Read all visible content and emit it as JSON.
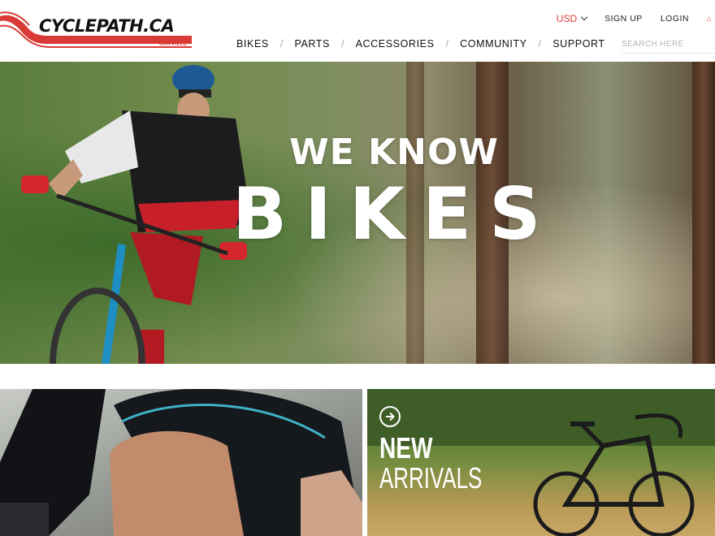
{
  "brand": {
    "name": "CYCLEPATH.CA",
    "location": "OAKVILLE",
    "color": "#d93a35"
  },
  "top_links": {
    "currency": "USD",
    "signup": "SIGN UP",
    "login": "LOGIN"
  },
  "nav": {
    "items": [
      "BIKES",
      "PARTS",
      "ACCESSORIES",
      "COMMUNITY",
      "SUPPORT"
    ],
    "separator": "/"
  },
  "search": {
    "placeholder": "SEARCH HERE",
    "value": ""
  },
  "hero": {
    "line1": "WE KNOW",
    "line2": "BIKES"
  },
  "tiles": {
    "new_arrivals": {
      "line1": "NEW",
      "line2": "ARRIVALS"
    }
  },
  "icons": {
    "currency_toggle": "chevron-down-icon",
    "cart": "cart-icon",
    "tile_link": "arrow-right-circle-icon"
  }
}
